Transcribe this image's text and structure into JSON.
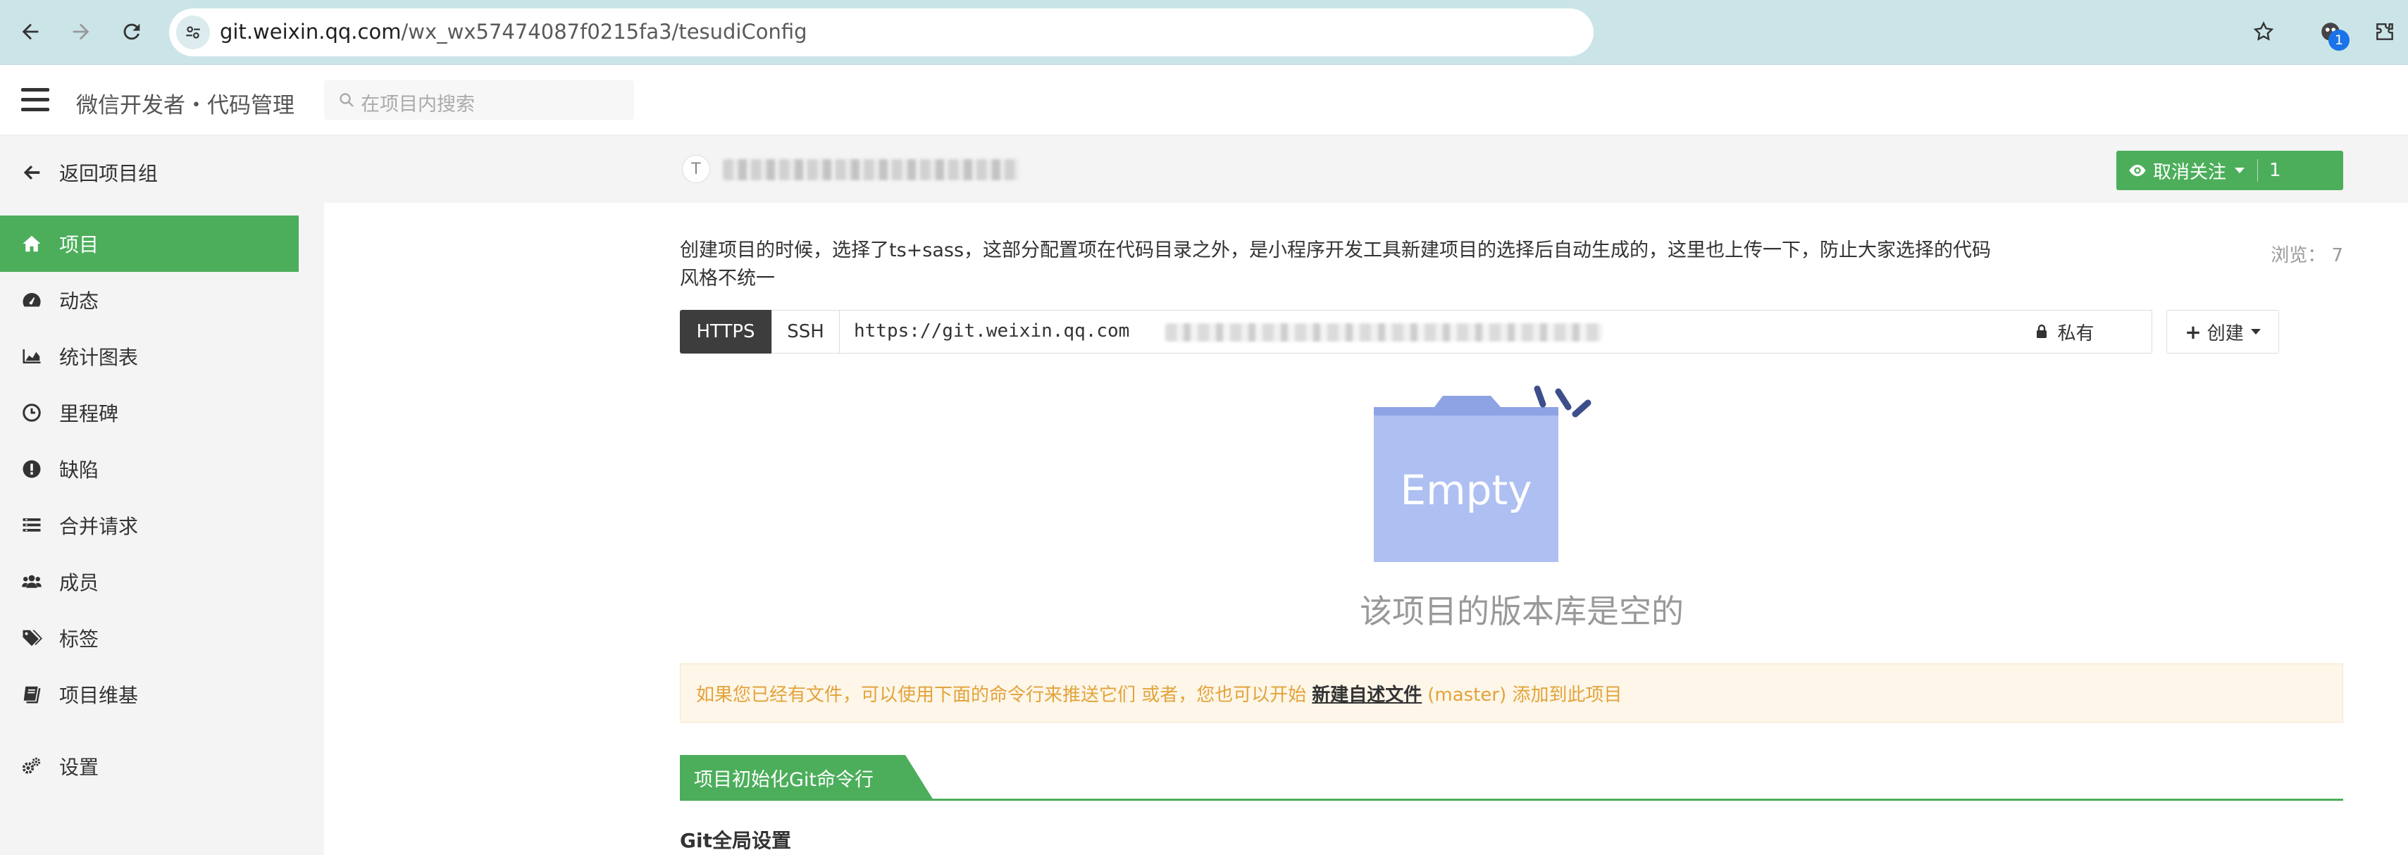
{
  "browser": {
    "url_host": "git.weixin.qq.com",
    "url_path": "/wx_wx57474087f0215fa3/tesudiConfig",
    "extension_badge": "1"
  },
  "header": {
    "app_title": "微信开发者・代码管理",
    "search_placeholder": "在项目内搜索"
  },
  "sidebar": {
    "back_label": "返回项目组",
    "items": [
      {
        "label": "项目",
        "icon": "home-icon",
        "active": true
      },
      {
        "label": "动态",
        "icon": "dashboard-icon"
      },
      {
        "label": "统计图表",
        "icon": "area-chart-icon"
      },
      {
        "label": "里程碑",
        "icon": "clock-icon"
      },
      {
        "label": "缺陷",
        "icon": "exclamation-icon"
      },
      {
        "label": "合并请求",
        "icon": "list-icon"
      },
      {
        "label": "成员",
        "icon": "users-icon"
      },
      {
        "label": "标签",
        "icon": "tags-icon"
      },
      {
        "label": "项目维基",
        "icon": "book-icon"
      },
      {
        "label": "设置",
        "icon": "cogs-icon"
      }
    ]
  },
  "project": {
    "avatar_letter": "T",
    "watch_label": "取消关注",
    "watch_count": "1",
    "description": "创建项目的时候，选择了ts+sass，这部分配置项在代码目录之外，是小程序开发工具新建项目的选择后自动生成的，这里也上传一下，防止大家选择的代码风格不统一",
    "views": "浏览： 7"
  },
  "clone": {
    "tab_https": "HTTPS",
    "tab_ssh": "SSH",
    "url_visible": "https://git.weixin.qq.com",
    "private_label": "私有",
    "create_label": "创建"
  },
  "empty": {
    "illustration_text": "Empty",
    "title": "该项目的版本库是空的"
  },
  "notice": {
    "prefix": "如果您已经有文件，可以使用下面的命令行来推送它们 或者，您也可以开始",
    "link": "新建自述文件",
    "suffix": "(master) 添加到此项目"
  },
  "git_section": {
    "tab_label": "项目初始化Git命令行",
    "global_settings": "Git全局设置"
  },
  "colors": {
    "accent_green": "#4cae5b",
    "notice_text": "#e3a33a",
    "folder_blue": "#aebff2",
    "chrome_teal": "#cbe4e7"
  }
}
